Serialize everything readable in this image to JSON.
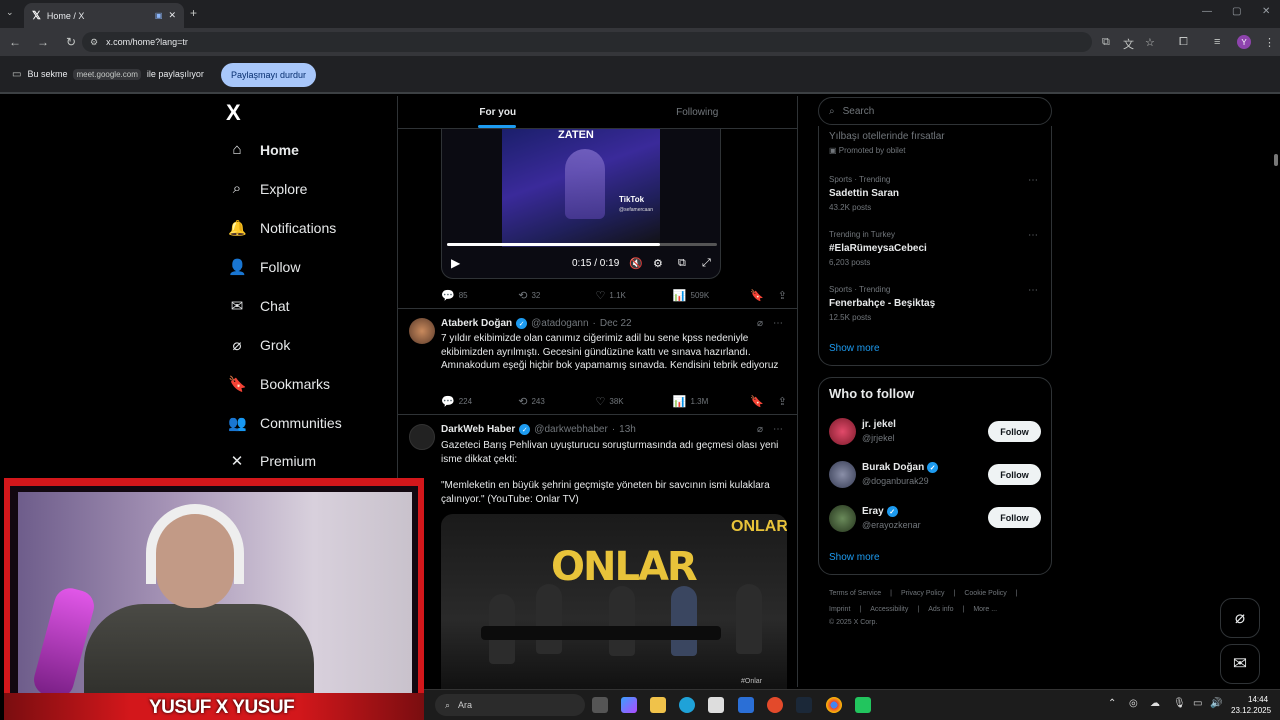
{
  "browser": {
    "tab_title": "Home / X",
    "url": "x.com/home?lang=tr",
    "share_text_before": "Bu sekme",
    "share_domain": "meet.google.com",
    "share_text_after": "ile paylaşılıyor",
    "stop_share_label": "Paylaşmayı durdur",
    "profile_letter": "Y"
  },
  "nav": {
    "logo": "X",
    "items": [
      {
        "label": "Home",
        "icon": "home-icon",
        "glyph": "⌂"
      },
      {
        "label": "Explore",
        "icon": "search-icon",
        "glyph": "⌕"
      },
      {
        "label": "Notifications",
        "icon": "bell-icon",
        "glyph": "🔔"
      },
      {
        "label": "Follow",
        "icon": "person-add-icon",
        "glyph": "👤"
      },
      {
        "label": "Chat",
        "icon": "mail-icon",
        "glyph": "✉"
      },
      {
        "label": "Grok",
        "icon": "grok-icon",
        "glyph": "⌀"
      },
      {
        "label": "Bookmarks",
        "icon": "bookmark-icon",
        "glyph": "🔖"
      },
      {
        "label": "Communities",
        "icon": "communities-icon",
        "glyph": "👥"
      },
      {
        "label": "Premium",
        "icon": "x-premium-icon",
        "glyph": "✕"
      }
    ]
  },
  "feed": {
    "tabs": [
      "For you",
      "Following"
    ],
    "video": {
      "overlay_text": "ZATEN",
      "tiktok_label": "TikTok",
      "tiktok_user": "@sefamercaan",
      "time": "0:15 / 0:19",
      "progress": 0.79
    },
    "video_post_actions": {
      "replies": "85",
      "reposts": "32",
      "likes": "1.1K",
      "views": "509K"
    },
    "posts": [
      {
        "name": "Ataberk Doğan",
        "handle": "@atadogann",
        "date": "Dec 22",
        "text": "7 yıldır ekibimizde olan canımız ciğerimiz adil bu sene kpss nedeniyle ekibimizden ayrılmıştı. Gecesini gündüzüne kattı ve sınava hazırlandı. Amınakodum eşeği hiçbir bok yapamamış sınavda. Kendisini tebrik ediyoruz",
        "replies": "224",
        "reposts": "243",
        "likes": "38K",
        "views": "1.3M"
      },
      {
        "name": "DarkWeb Haber",
        "handle": "@darkwebhaber",
        "date": "13h",
        "text": "Gazeteci Barış Pehlivan uyuşturucu soruşturmasında adı geçmesi olası yeni isme dikkat çekti:",
        "quote": "\"Memleketin en büyük şehrini geçmişte yöneten bir savcının ismi kulaklara çalınıyor.\" (YouTube: Onlar TV)",
        "image_title": "ONLAR",
        "image_tag": "#Onlar"
      }
    ]
  },
  "sidebar": {
    "search_placeholder": "Search",
    "promoted_title": "Yılbaşı otellerinde fırsatlar",
    "promoted_by": "Promoted by obilet",
    "trends": [
      {
        "meta": "Sports · Trending",
        "title": "Sadettin Saran",
        "posts": "43.2K posts"
      },
      {
        "meta": "Trending in Turkey",
        "title": "#ElaRümeysaCebeci",
        "posts": "6,203 posts"
      },
      {
        "meta": "Sports · Trending",
        "title": "Fenerbahçe - Beşiktaş",
        "posts": "12.5K posts"
      }
    ],
    "show_more": "Show more",
    "who_to_follow": "Who to follow",
    "follow_label": "Follow",
    "suggestions": [
      {
        "name": "jr. jekel",
        "handle": "@jrjekel",
        "verified": false
      },
      {
        "name": "Burak Doğan",
        "handle": "@doganburak29",
        "verified": true
      },
      {
        "name": "Eray",
        "handle": "@erayozkenar",
        "verified": true
      }
    ],
    "footer": [
      "Terms of Service",
      "|",
      "Privacy Policy",
      "|",
      "Cookie Policy",
      "|"
    ],
    "footer2": [
      "Imprint",
      "|",
      "Accessibility",
      "|",
      "Ads info",
      "|",
      "More ..."
    ],
    "copyright": "© 2025 X Corp."
  },
  "webcam": {
    "label": "YUSUF X YUSUF"
  },
  "taskbar": {
    "search_label": "Ara",
    "time": "14:44",
    "date": "23.12.2025"
  }
}
